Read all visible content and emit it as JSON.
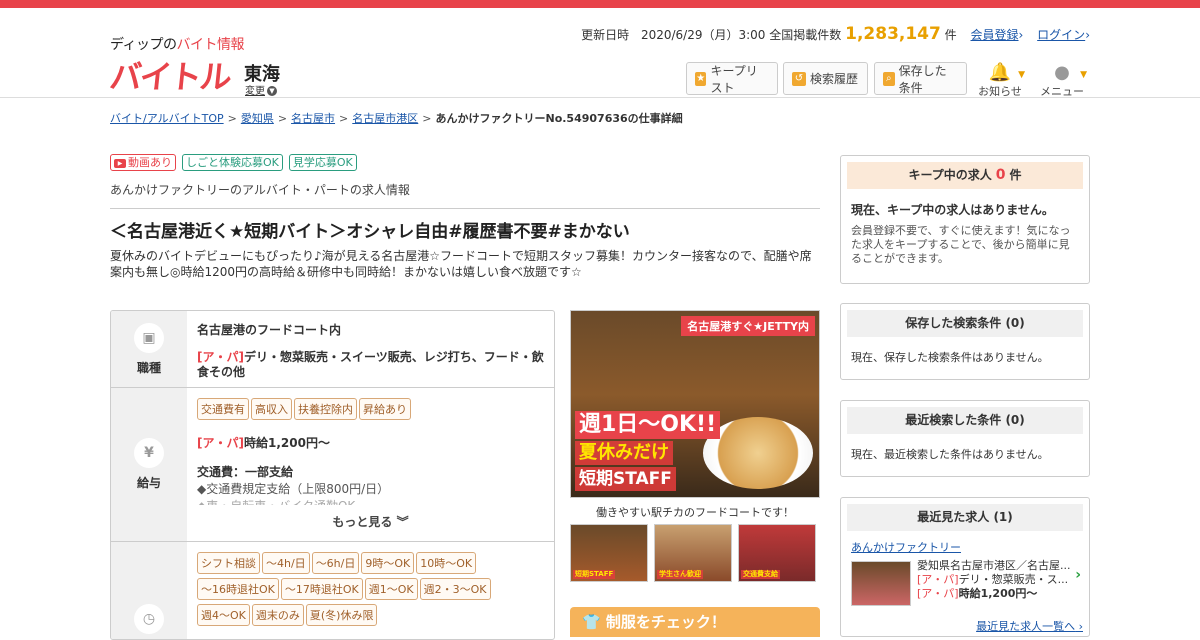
{
  "header": {
    "logo_small_prefix": "ディップの",
    "logo_small_red": "バイト情報",
    "logo_big": "バイトル",
    "region": "東海",
    "region_change": "変更",
    "updated_label": "更新日時",
    "updated_value": "2020/6/29（月）3:00",
    "total_label": "全国掲載件数",
    "total_count": "1,283,147",
    "total_unit": "件",
    "register_link": "会員登録",
    "login_link": "ログイン",
    "keep_list_button": "キープリスト",
    "history_button": "検索履歴",
    "saved_button": "保存した条件",
    "notice_label": "お知らせ",
    "menu_label": "メニュー"
  },
  "breadcrumb": {
    "items": [
      "バイト/アルバイトTOP",
      "愛知県",
      "名古屋市",
      "名古屋市港区"
    ],
    "current": "あんかけファクトリーNo.54907636の仕事詳細"
  },
  "tags": {
    "video": "動画あり",
    "trial": "しごと体験応募OK",
    "tour": "見学応募OK"
  },
  "subtitle": "あんかけファクトリーのアルバイト・パートの求人情報",
  "job": {
    "title": "＜名古屋港近く★短期バイト＞オシャレ自由#履歴書不要#まかない",
    "description": "夏休みのバイトデビューにもぴったり♪海が見える名古屋港☆フードコートで短期スタッフ募集！カウンター接客なので、配膳や席案内も無し◎時給1200円の高時給＆研修中も同時給！まかないは嬉しい食べ放題です☆"
  },
  "info": {
    "job_type_label": "職種",
    "job_place": "名古屋港のフードコート内",
    "job_type_prefix": "[ア・パ]",
    "job_type_text": "デリ・惣菜販売・スイーツ販売、レジ打ち、フード・飲食その他",
    "salary_label": "給与",
    "salary_chips": [
      "交通費有",
      "高収入",
      "扶養控除内",
      "昇給あり"
    ],
    "salary_prefix": "[ア・パ]",
    "salary_text": "時給1,200円～",
    "transport_head": "交通費：一部支給",
    "transport_detail": "◆交通費規定支給（上限800円/日）",
    "transport_detail2": "◆車・自転車・バイク通勤OK",
    "more_label": "もっと見る",
    "shift_chips": [
      "シフト相談",
      "～4h/日",
      "～6h/日",
      "9時～OK",
      "10時～OK",
      "～16時退社OK",
      "～17時退社OK",
      "週1〜OK",
      "週2・3〜OK",
      "週4〜OK",
      "週末のみ",
      "夏(冬)休み限"
    ]
  },
  "photo": {
    "banner": "名古屋港すぐ★JETTY内",
    "line1": "週1日〜OK!!",
    "line2": "夏休みだけ",
    "line3": "短期STAFF",
    "caption": "働きやすい駅チカのフードコートです！",
    "thumb_texts": [
      "短期STAFF",
      "学生さん歓迎",
      "交通費支給"
    ],
    "uniform_label": "制服をチェック！"
  },
  "sidebar": {
    "keep_title": "キープ中の求人",
    "keep_count": "0",
    "keep_unit": "件",
    "keep_empty": "現在、キープ中の求人はありません。",
    "keep_hint": "会員登録不要で、すぐに使えます！気になった求人をキープすることで、後から簡単に見ることができます。",
    "saved_title": "保存した検索条件",
    "saved_count": "(0)",
    "saved_empty": "現在、保存した検索条件はありません。",
    "recent_search_title": "最近検索した条件",
    "recent_search_count": "(0)",
    "recent_search_empty": "現在、最近検索した条件はありません。",
    "recent_view_title": "最近見た求人",
    "recent_view_count": "(1)",
    "recent_job_name": "あんかけファクトリー",
    "recent_job_place": "愛知県名古屋市港区／名古屋...",
    "recent_job_prefix": "[ア・パ]",
    "recent_job_type": "デリ・惣菜販売・ス...",
    "recent_job_salary_prefix": "[ア・パ]",
    "recent_job_salary": "時給1,200円～",
    "recent_more": "最近見た求人一覧へ"
  },
  "colors": {
    "brand_red": "#e8434a",
    "accent_orange": "#e8a000",
    "link_blue": "#1a56a8"
  }
}
